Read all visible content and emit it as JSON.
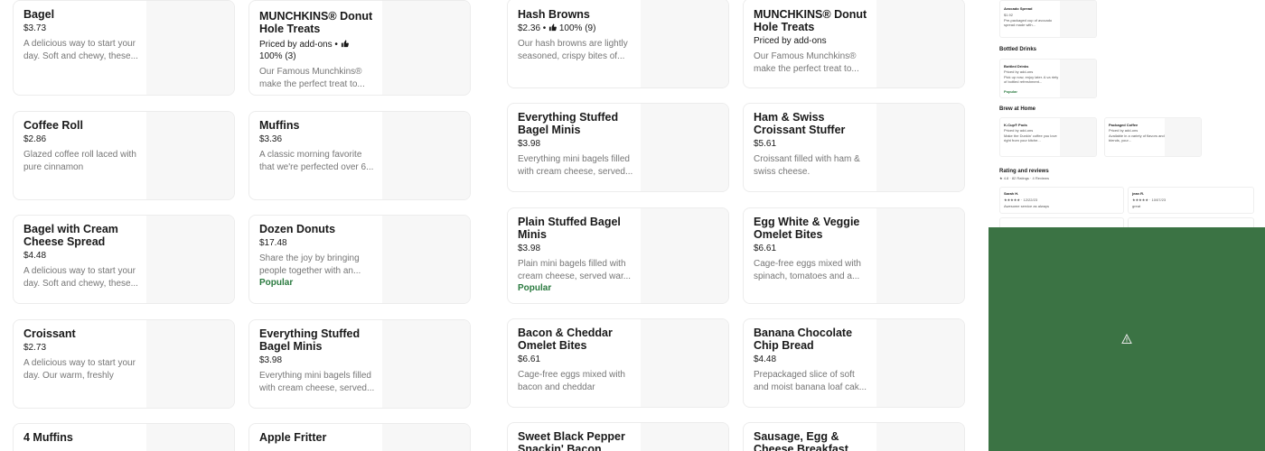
{
  "columns": [
    {
      "items": [
        {
          "name": "Bagel",
          "price": "$3.73",
          "desc": "A delicious way to start your day. Soft and chewy, these..."
        },
        {
          "name": "Coffee Roll",
          "price": "$2.86",
          "desc": "Glazed coffee roll laced with pure cinnamon"
        },
        {
          "name": "Bagel with Cream Cheese Spread",
          "price": "$4.48",
          "desc": "A delicious way to start your day. Soft and chewy, these..."
        },
        {
          "name": "Croissant",
          "price": "$2.73",
          "desc": "A delicious way to start your day. Our warm, freshly bake..."
        },
        {
          "name": "4 Muffins",
          "price": "",
          "desc": ""
        }
      ]
    },
    {
      "items": [
        {
          "name": "MUNCHKINS® Donut Hole Treats",
          "price": "Priced by add-ons •",
          "rating": "100% (3)",
          "desc": "Our Famous Munchkins® make the perfect treat to..."
        },
        {
          "name": "Muffins",
          "price": "$3.36",
          "desc": "A classic morning favorite that we're perfected over 6..."
        },
        {
          "name": "Dozen Donuts",
          "price": "$17.48",
          "desc": "Share the joy by bringing people together with an...",
          "badge": "Popular"
        },
        {
          "name": "Everything Stuffed Bagel Minis",
          "price": "$3.98",
          "desc": "Everything mini bagels filled with cream cheese, served..."
        },
        {
          "name": "Apple Fritter",
          "price": "",
          "desc": ""
        }
      ]
    },
    {
      "items": [
        {
          "name": "Hash Browns",
          "price": "$2.36 •",
          "rating": "100% (9)",
          "desc": "Our hash browns are lightly seasoned, crispy bites of..."
        },
        {
          "name": "Everything Stuffed Bagel Minis",
          "price": "$3.98",
          "desc": "Everything mini bagels filled with cream cheese, served..."
        },
        {
          "name": "Plain Stuffed Bagel Minis",
          "price": "$3.98",
          "desc": "Plain mini bagels filled with cream cheese, served war...",
          "badge": "Popular"
        },
        {
          "name": "Bacon & Cheddar Omelet Bites",
          "price": "$6.61",
          "desc": "Cage-free eggs mixed with bacon and cheddar cheese..."
        },
        {
          "name": "Sweet Black Pepper Snackin' Bacon",
          "price": "",
          "desc": ""
        }
      ]
    },
    {
      "items": [
        {
          "name": "MUNCHKINS® Donut Hole Treats",
          "price": "Priced by add-ons",
          "desc": "Our Famous Munchkins® make the perfect treat to..."
        },
        {
          "name": "Ham & Swiss Croissant Stuffer",
          "price": "$5.61",
          "desc": "Croissant filled with ham & swiss cheese."
        },
        {
          "name": "Egg White & Veggie Omelet Bites",
          "price": "$6.61",
          "desc": "Cage-free eggs mixed with spinach, tomatoes and a..."
        },
        {
          "name": "Banana Chocolate Chip Bread",
          "price": "$4.48",
          "desc": "Prepackaged slice of soft and moist banana loaf cak..."
        },
        {
          "name": "Sausage, Egg & Cheese Breakfast Empanada",
          "price": "",
          "desc": ""
        }
      ]
    }
  ],
  "mini": {
    "avocado": {
      "name": "Avocado Spread",
      "price": "$1.92",
      "desc": "Pre-packaged cup of avocado spread made with..."
    },
    "bottled_title": "Bottled Drinks",
    "bottled": {
      "name": "Bottled Drinks",
      "price": "Priced by add-ons",
      "desc": "Pick up now, enjoy later. A va riety of bottled refreshment...",
      "badge": "Popular"
    },
    "brew_title": "Brew at Home",
    "kcup": {
      "name": "K-Cup® Pods",
      "price": "Priced by add-ons",
      "desc": "Make the Dunkin' coffee you love right from your kitche..."
    },
    "packaged": {
      "name": "Packaged Coffee",
      "price": "Priced by add-ons",
      "desc": "Available in a variety of flavors and blends, your..."
    },
    "rating_title": "Rating and reviews",
    "rating_summary": "★ 4.8 · 82 Ratings · 4 Reviews",
    "review1": {
      "author": "Sarah H.",
      "stars": "★★★★★ · 12/22/23",
      "text": "Awesome service as always"
    },
    "review2": {
      "author": "jean R.",
      "stars": "★★★★★ · 10/07/23",
      "text": "great"
    }
  },
  "colors": {
    "popular": "#2a7a3f",
    "broken_bg": "#3b7344"
  },
  "icons": {
    "thumb": "thumbs-up-icon",
    "warning": "warning-icon"
  }
}
